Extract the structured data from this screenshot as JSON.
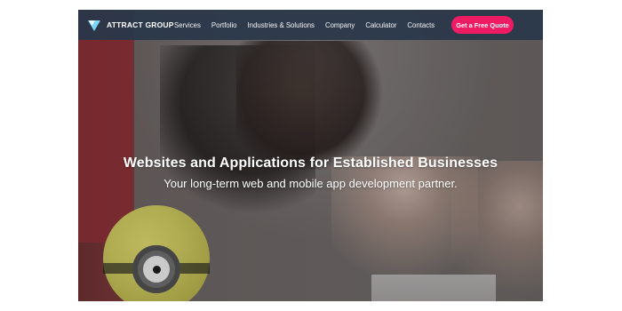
{
  "header": {
    "logo_text": "ATTRACT GROUP",
    "nav": [
      "Services",
      "Portfolio",
      "Industries & Solutions",
      "Company",
      "Calculator",
      "Contacts"
    ],
    "cta_label": "Get a Free Quote",
    "accent": "#ef1b63",
    "bar_color": "#29374b"
  },
  "hero": {
    "title": "Websites and Applications for Established Businesses",
    "subtitle": "Your long-term web and mobile app development partner."
  },
  "icons": {
    "logo_mark": "attract-group-logo-icon"
  }
}
